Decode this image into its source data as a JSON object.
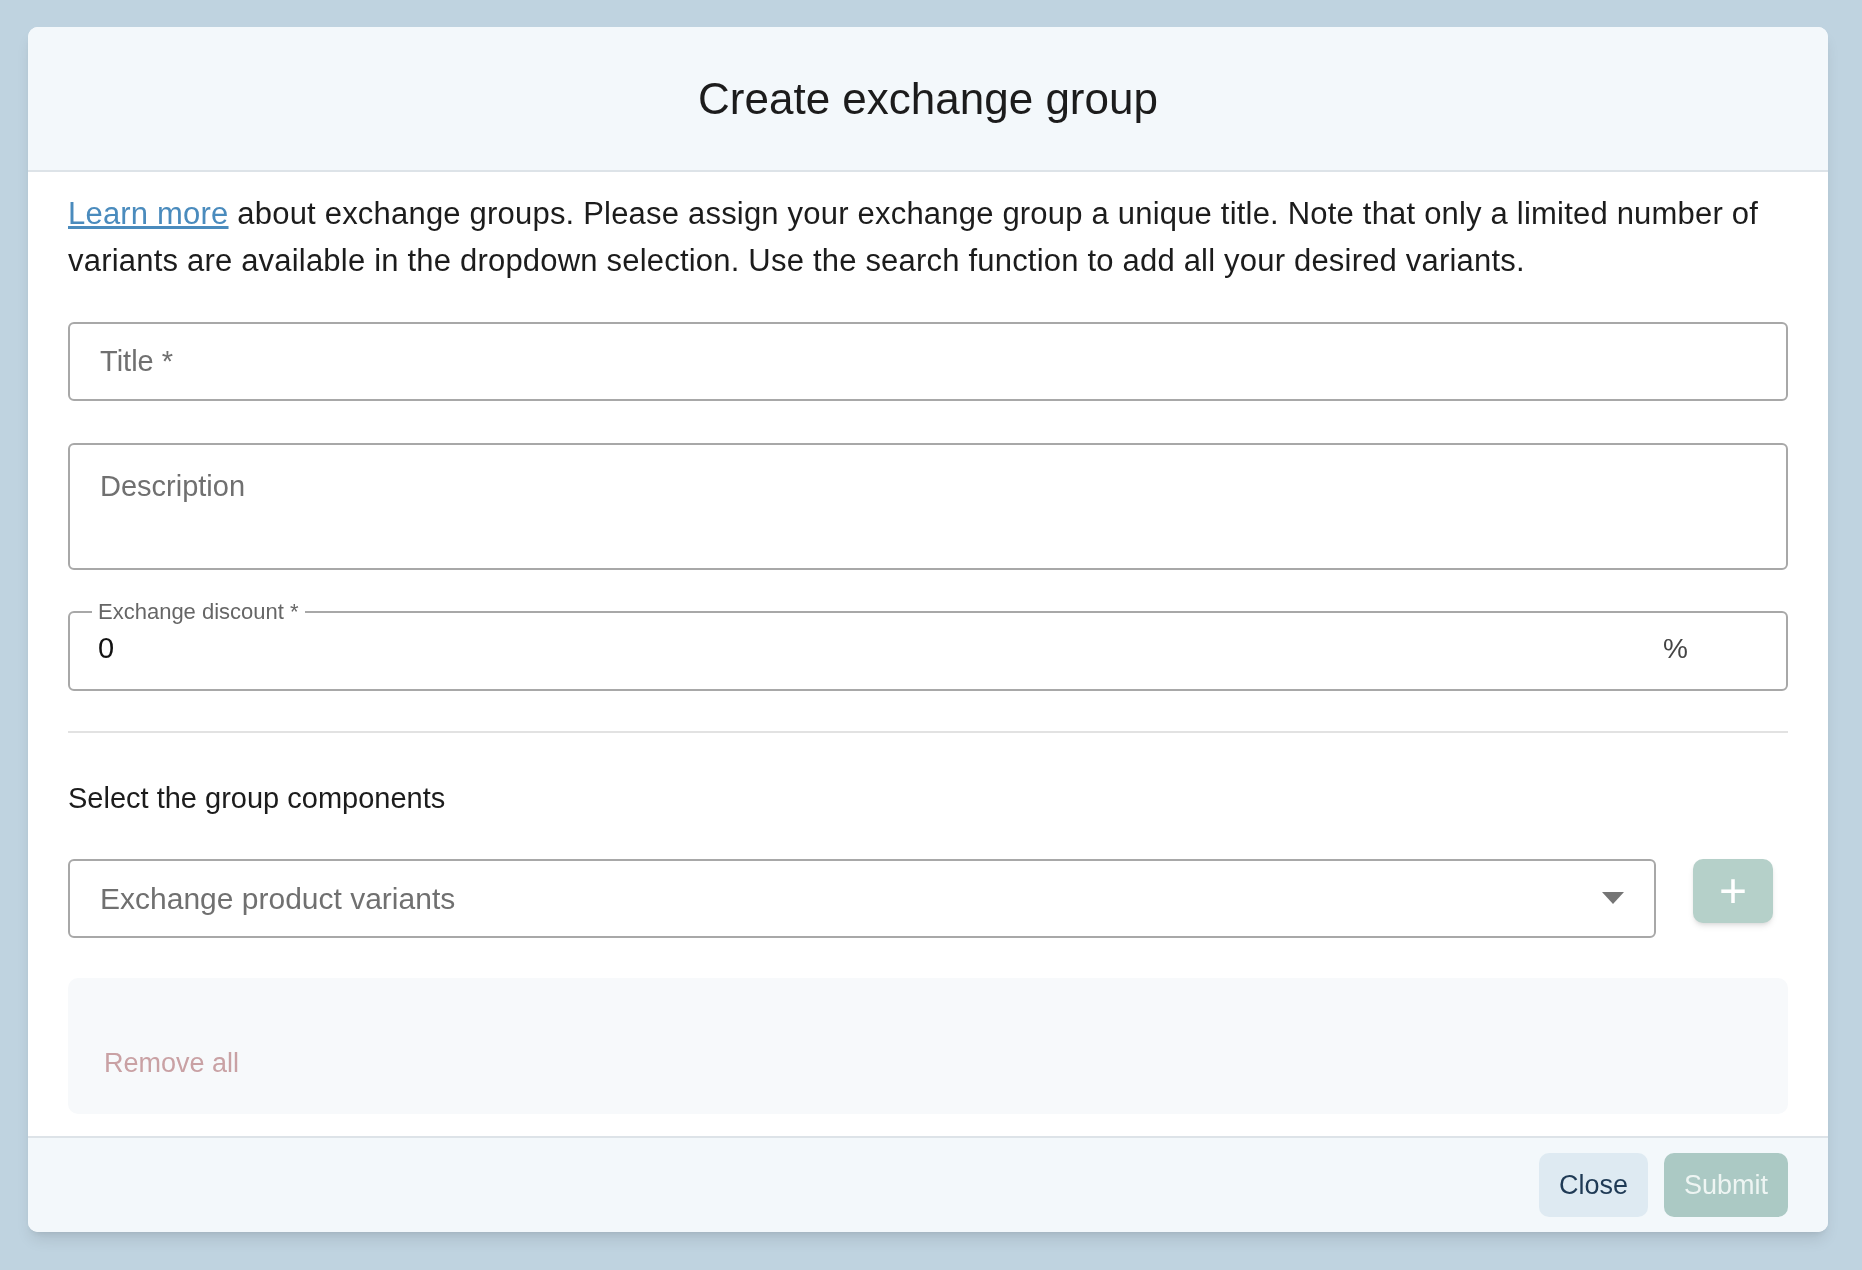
{
  "dialog": {
    "title": "Create exchange group",
    "intro": {
      "link": "Learn more",
      "text": " about exchange groups. Please assign your exchange group a unique title. Note that only a limited number of variants are available in the dropdown selection. Use the search function to add all your desired variants."
    },
    "fields": [
      {
        "kind": "text",
        "placeholder": "Title *"
      },
      {
        "kind": "textarea",
        "placeholder": "Description"
      },
      {
        "kind": "number",
        "label": "Exchange discount *",
        "value": "0",
        "suffix": "%"
      }
    ],
    "components": {
      "heading": "Select the group components",
      "select": {
        "placeholder": "Exchange product variants"
      },
      "add_button": {
        "label": "+",
        "disabled": true
      },
      "remove_all": {
        "label": "Remove all",
        "disabled": true
      }
    },
    "buttons": [
      {
        "label": "Close",
        "kind": "secondary",
        "disabled": false
      },
      {
        "label": "Submit",
        "kind": "primary",
        "disabled": true
      }
    ]
  }
}
